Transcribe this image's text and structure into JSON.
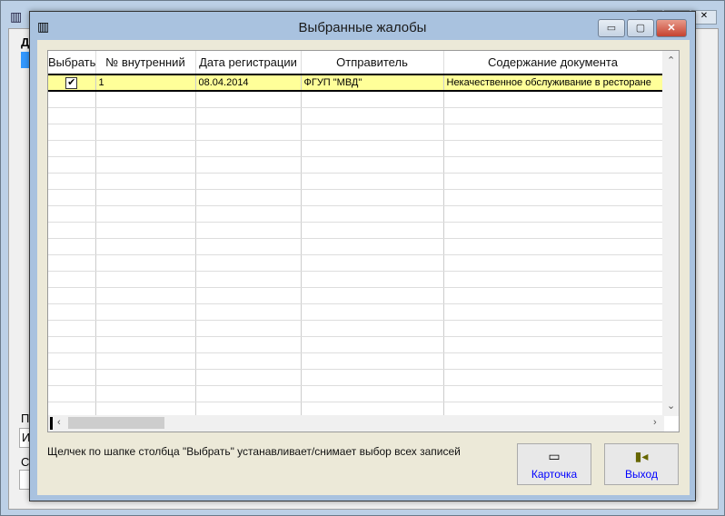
{
  "background": {
    "labels": [
      "Д",
      "П",
      "С"
    ],
    "input_text": "И"
  },
  "dialog": {
    "title": "Выбранные жалобы",
    "minimize": "▭",
    "maximize": "▢",
    "close": "✕"
  },
  "grid": {
    "columns": [
      "Выбрать",
      "№ внутренний",
      "Дата регистрации",
      "Отправитель",
      "Содержание документа"
    ],
    "rows": [
      {
        "checked": true,
        "num": "1",
        "date": "08.04.2014",
        "sender": "ФГУП \"МВД\"",
        "content": "Некачественное обслуживание в ресторане"
      }
    ]
  },
  "hint": "Щелчек по шапке столбца \"Выбрать\" устанавливает/снимает выбор всех записей",
  "buttons": {
    "card": "Карточка",
    "exit": "Выход"
  },
  "check_mark": "✔"
}
